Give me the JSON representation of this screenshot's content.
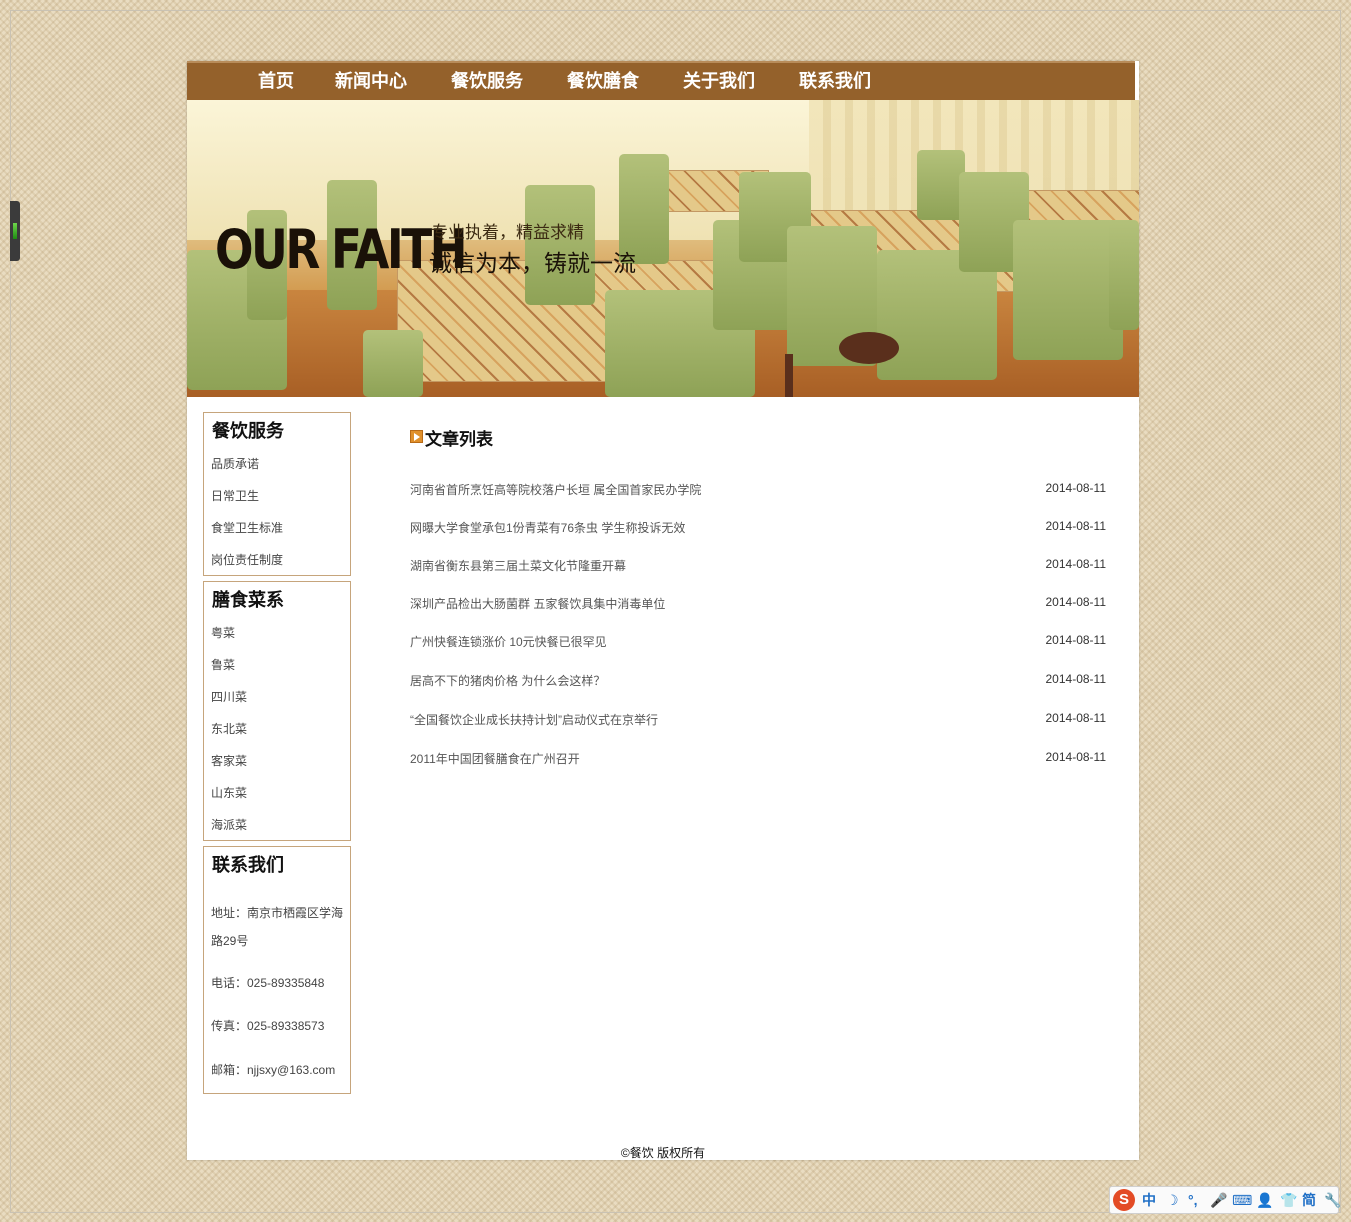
{
  "nav": {
    "items": [
      "首页",
      "新闻中心",
      "餐饮服务",
      "餐饮膳食",
      "关于我们",
      "联系我们"
    ]
  },
  "banner": {
    "logo_text": "OUR FAITH",
    "slogan_small": "专业执着，精益求精",
    "slogan_large": "诚信为本，铸就一流"
  },
  "sidebar": {
    "service": {
      "title": "餐饮服务",
      "items": [
        "品质承诺",
        "日常卫生",
        "食堂卫生标准",
        "岗位责任制度"
      ]
    },
    "cuisine": {
      "title": "膳食菜系",
      "items": [
        "粤菜",
        "鲁菜",
        "四川菜",
        "东北菜",
        "客家菜",
        "山东菜",
        "海派菜"
      ]
    },
    "contact": {
      "title": "联系我们",
      "address": "地址：南京市栖霞区学海路29号",
      "phone": "电话：025-89335848",
      "fax": "传真：025-89338573",
      "email": "邮箱：njjsxy@163.com"
    }
  },
  "main": {
    "title": "文章列表",
    "articles": [
      {
        "title": "河南省首所烹饪高等院校落户长垣 属全国首家民办学院",
        "date": "2014-08-11"
      },
      {
        "title": "网曝大学食堂承包1份青菜有76条虫 学生称投诉无效",
        "date": "2014-08-11"
      },
      {
        "title": "湖南省衡东县第三届土菜文化节隆重开幕",
        "date": "2014-08-11"
      },
      {
        "title": "深圳产品检出大肠菌群 五家餐饮具集中消毒单位",
        "date": "2014-08-11"
      },
      {
        "title": "广州快餐连锁涨价 10元快餐已很罕见",
        "date": "2014-08-11"
      },
      {
        "title": "居高不下的猪肉价格 为什么会这样？",
        "date": "2014-08-11"
      },
      {
        "title": "“全国餐饮企业成长扶持计划”启动仪式在京举行",
        "date": "2014-08-11"
      },
      {
        "title": "2011年中国团餐膳食在广州召开",
        "date": "2014-08-11"
      }
    ]
  },
  "footer": {
    "text": "©餐饮 版权所有"
  },
  "ime_bar": {
    "logo": "S",
    "mode": "中",
    "simplified": "简"
  },
  "colors": {
    "nav_bg": "#94612b",
    "box_border": "#c6a57c",
    "accent_icon": "#e0902b"
  }
}
